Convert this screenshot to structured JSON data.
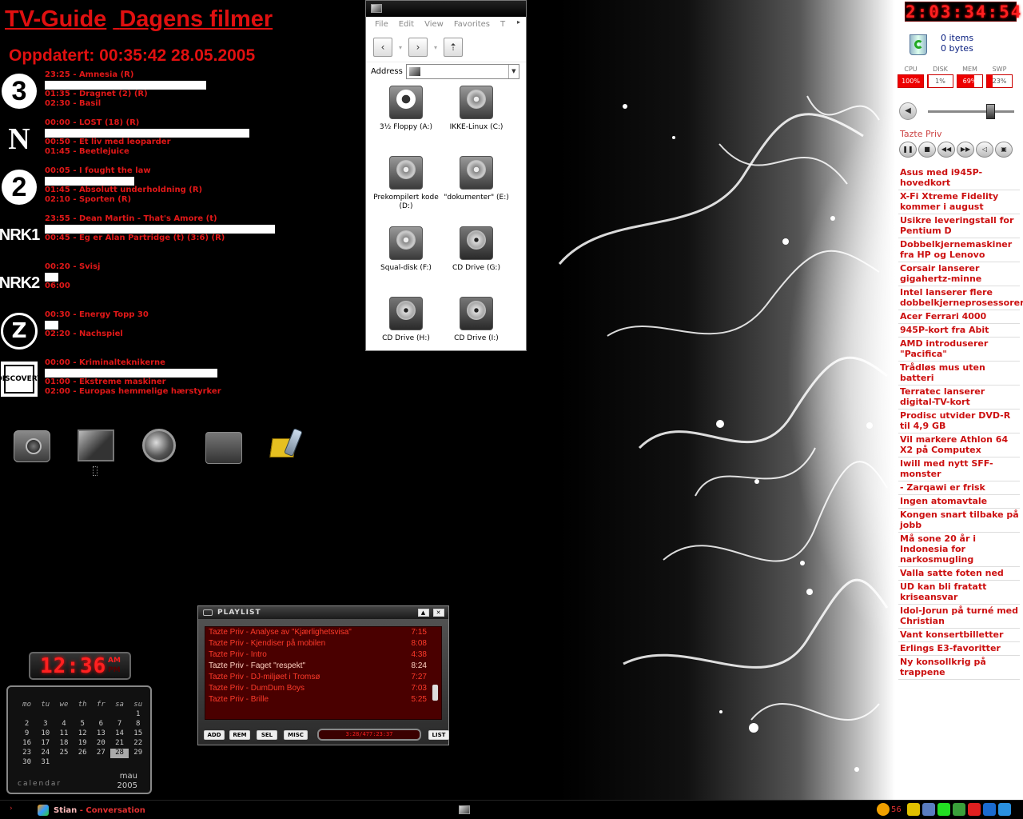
{
  "tvguide": {
    "title_part1": "TV-Guide",
    "title_part2": "Dagens filmer",
    "updated": "Oppdatert: 00:35:42 28.05.2005",
    "channels": [
      {
        "logo": "3",
        "programs": [
          "23:25 - Amnesia (R)",
          "01:35 - Dragnet (2) (R)",
          "02:30 - Basil"
        ]
      },
      {
        "logo": "N",
        "programs": [
          "00:00 - LOST (18) (R)",
          "00:50 - Et liv med leoparder",
          "01:45 - Beetlejuice"
        ]
      },
      {
        "logo": "2",
        "programs": [
          "00:05 - I fought the law",
          "01:45 - Absolutt underholdning (R)",
          "02:10 - Sporten (R)"
        ]
      },
      {
        "logo": "NRK1",
        "programs": [
          "23:55 - Dean Martin - That's Amore (t)",
          "00:45 - Eg er Alan Partridge (t) (3:6) (R)"
        ]
      },
      {
        "logo": "NRK2",
        "programs": [
          "00:20 - Svisj",
          "06:00"
        ]
      },
      {
        "logo": "Z",
        "programs": [
          "00:30 - Energy Topp 30",
          "02:20 - Nachspiel"
        ]
      },
      {
        "logo": "DISCOVERY",
        "programs": [
          "00:00 - Kriminalteknikerne",
          "01:00 - Ekstreme maskiner",
          "02:00 - Europas hemmelige hærstyrker"
        ]
      }
    ],
    "progress": [
      0.7,
      0.89,
      0.39,
      1.0,
      0.06,
      0.06,
      0.75
    ]
  },
  "desktop_icons": [
    "camera-icon",
    "monitor-icon",
    "globe-icon",
    "recycle-icon",
    "folder-phone-icon"
  ],
  "explorer": {
    "menu": [
      "File",
      "Edit",
      "View",
      "Favorites",
      "T"
    ],
    "address_label": "Address",
    "drives": [
      {
        "label": "3½ Floppy (A:)",
        "kind": "floppy"
      },
      {
        "label": "IKKE-Linux (C:)",
        "kind": "hdd"
      },
      {
        "label": "Prekompilert kode (D:)",
        "kind": "hdd"
      },
      {
        "label": "\"dokumenter\" (E:)",
        "kind": "hdd"
      },
      {
        "label": "Squal-disk (F:)",
        "kind": "hdd"
      },
      {
        "label": "CD Drive (G:)",
        "kind": "cd"
      },
      {
        "label": "CD Drive (H:)",
        "kind": "cd"
      },
      {
        "label": "CD Drive (I:)",
        "kind": "cd"
      }
    ]
  },
  "sidebar": {
    "clock": "2:03:34:54",
    "recycle_items": "0 items",
    "recycle_bytes": "0 bytes",
    "meters": [
      {
        "label": "CPU",
        "value": "100%",
        "level": 1.0
      },
      {
        "label": "DISK",
        "value": "1%",
        "level": 0.01
      },
      {
        "label": "MEM",
        "value": "69%",
        "level": 0.69
      },
      {
        "label": "SWP",
        "value": "23%",
        "level": 0.23
      }
    ],
    "volume_level": 0.72,
    "now_playing": "Tazte Priv",
    "news": [
      "Asus med i945P-hovedkort",
      "X-Fi Xtreme Fidelity kommer i august",
      "Usikre leveringstall for Pentium D",
      "Dobbelkjernemaskiner fra HP og Lenovo",
      "Corsair lanserer gigahertz-minne",
      "Intel lanserer flere dobbelkjerneprosessorer",
      "Acer Ferrari 4000",
      "945P-kort fra Abit",
      "AMD introduserer \"Pacifica\"",
      "Trådløs mus uten batteri",
      "Terratec lanserer digital-TV-kort",
      "Prodisc utvider DVD-R til 4,9 GB",
      "Vil markere Athlon 64 X2 på Computex",
      "Iwill med nytt SFF-monster",
      "- Zarqawi er frisk",
      "Ingen atomavtale",
      "Kongen snart tilbake på jobb",
      "Må sone 20 år i Indonesia for narkosmugling",
      "Valla satte foten ned",
      "UD kan bli fratatt kriseansvar",
      "Idol-Jorun på turné med Christian",
      "Vant konsertbilletter",
      "Erlings E3-favoritter",
      "Ny konsollkrig på trappene"
    ]
  },
  "playlist": {
    "title": "PLAYLIST",
    "tracks": [
      {
        "title": "Tazte Priv - Analyse av \"Kjærlighetsvisa\"",
        "time": "7:15"
      },
      {
        "title": "Tazte Priv - Kjendiser på mobilen",
        "time": "8:08"
      },
      {
        "title": "Tazte Priv - Intro",
        "time": "4:38"
      },
      {
        "title": "Tazte Priv - Faget \"respekt\"",
        "time": "8:24"
      },
      {
        "title": "Tazte Priv - DJ-miljøet i Tromsø",
        "time": "7:27"
      },
      {
        "title": "Tazte Priv - DumDum Boys",
        "time": "7:03"
      },
      {
        "title": "Tazte Priv - Brille",
        "time": "5:25"
      }
    ],
    "buttons": [
      "ADD",
      "REM",
      "SEL",
      "MISC",
      "LIST"
    ],
    "time_display": "3:28/477:23:37"
  },
  "clock": {
    "digits": "12:36",
    "am": "AM",
    "pm": "PM"
  },
  "calendar": {
    "weekdays": [
      "mo",
      "tu",
      "we",
      "th",
      "fr",
      "sa",
      "su"
    ],
    "weeks": [
      [
        "",
        "",
        "",
        "",
        "",
        "",
        "1"
      ],
      [
        "2",
        "3",
        "4",
        "5",
        "6",
        "7",
        "8"
      ],
      [
        "9",
        "10",
        "11",
        "12",
        "13",
        "14",
        "15"
      ],
      [
        "16",
        "17",
        "18",
        "19",
        "20",
        "21",
        "22"
      ],
      [
        "23",
        "24",
        "25",
        "26",
        "27",
        "28",
        "29"
      ],
      [
        "30",
        "31",
        "",
        "",
        "",
        "",
        ""
      ]
    ],
    "today": "28",
    "label": "calendar",
    "month": "mau",
    "year": "2005"
  },
  "taskbar": {
    "start": "›",
    "task_user": "Stian",
    "task_label": " - Conversation",
    "temp": "56"
  },
  "colors": {
    "accent": "#e01010",
    "tray_colors": [
      "#f0a000",
      "#e0c000",
      "#5a7cc0",
      "#22dd22",
      "#3aa03a",
      "#e02020",
      "#1a6ad0",
      "#2a90e0"
    ]
  }
}
